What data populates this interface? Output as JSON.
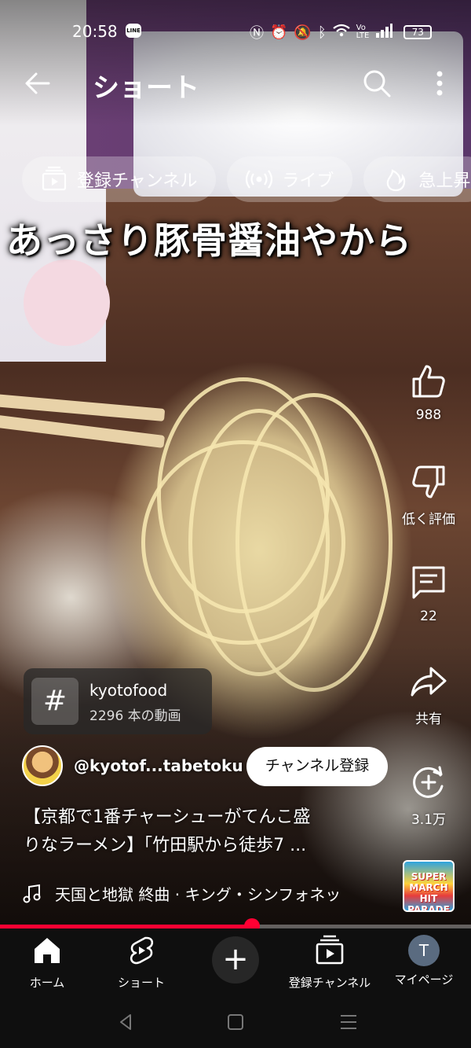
{
  "status_bar": {
    "time": "20:58",
    "line_badge": "LINE",
    "battery": "73",
    "icons": [
      "nfc-icon",
      "alarm-icon",
      "mute-icon",
      "bluetooth-icon",
      "wifi-icon",
      "volte-icon",
      "signal-icon"
    ]
  },
  "header": {
    "title": "ショート"
  },
  "chips": [
    {
      "label": "登録チャンネル",
      "icon": "subscriptions-icon"
    },
    {
      "label": "ライブ",
      "icon": "live-icon"
    },
    {
      "label": "急上昇",
      "icon": "trending-icon"
    }
  ],
  "video": {
    "overlay_caption": "あっさり豚骨醤油やから",
    "title_line1": "【京都で1番チャーシューがてんこ盛",
    "title_line2": "りなラーメン】「竹田駅から徒歩7 ...",
    "progress_fraction": 0.535
  },
  "actions": {
    "like_count": "988",
    "dislike_label": "低く評価",
    "comment_count": "22",
    "share_label": "共有",
    "remix_count": "3.1万"
  },
  "hashtag": {
    "symbol": "#",
    "name": "kyotofood",
    "count": "2296 本の動画"
  },
  "channel": {
    "handle": "@kyotof...tabetoku",
    "subscribe_label": "チャンネル登録"
  },
  "music": {
    "text": "天国と地獄 終曲 · キング・シンフォネッ",
    "album_text": "SUPER MARCH HIT PARADE"
  },
  "bottom_nav": {
    "home": "ホーム",
    "shorts": "ショート",
    "create": "+",
    "subscriptions": "登録チャンネル",
    "me": "マイページ",
    "me_initial": "T"
  },
  "colors": {
    "accent_red": "#ff0033",
    "nav_bg": "#0f0f0f"
  }
}
